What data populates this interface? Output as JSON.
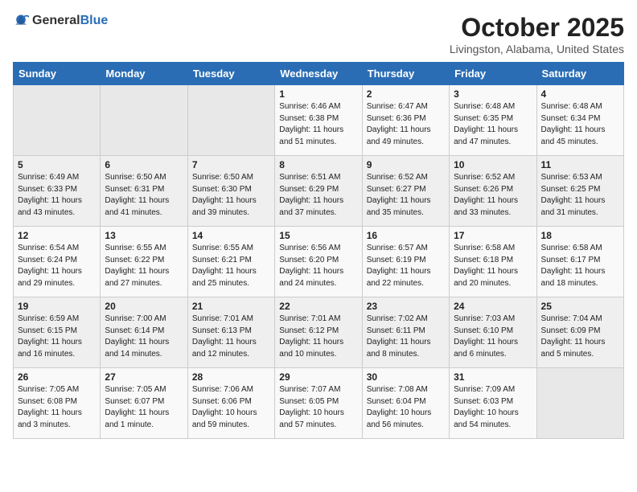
{
  "header": {
    "logo_general": "General",
    "logo_blue": "Blue",
    "month_title": "October 2025",
    "location": "Livingston, Alabama, United States"
  },
  "days_of_week": [
    "Sunday",
    "Monday",
    "Tuesday",
    "Wednesday",
    "Thursday",
    "Friday",
    "Saturday"
  ],
  "weeks": [
    [
      {
        "day": "",
        "info": ""
      },
      {
        "day": "",
        "info": ""
      },
      {
        "day": "",
        "info": ""
      },
      {
        "day": "1",
        "info": "Sunrise: 6:46 AM\nSunset: 6:38 PM\nDaylight: 11 hours\nand 51 minutes."
      },
      {
        "day": "2",
        "info": "Sunrise: 6:47 AM\nSunset: 6:36 PM\nDaylight: 11 hours\nand 49 minutes."
      },
      {
        "day": "3",
        "info": "Sunrise: 6:48 AM\nSunset: 6:35 PM\nDaylight: 11 hours\nand 47 minutes."
      },
      {
        "day": "4",
        "info": "Sunrise: 6:48 AM\nSunset: 6:34 PM\nDaylight: 11 hours\nand 45 minutes."
      }
    ],
    [
      {
        "day": "5",
        "info": "Sunrise: 6:49 AM\nSunset: 6:33 PM\nDaylight: 11 hours\nand 43 minutes."
      },
      {
        "day": "6",
        "info": "Sunrise: 6:50 AM\nSunset: 6:31 PM\nDaylight: 11 hours\nand 41 minutes."
      },
      {
        "day": "7",
        "info": "Sunrise: 6:50 AM\nSunset: 6:30 PM\nDaylight: 11 hours\nand 39 minutes."
      },
      {
        "day": "8",
        "info": "Sunrise: 6:51 AM\nSunset: 6:29 PM\nDaylight: 11 hours\nand 37 minutes."
      },
      {
        "day": "9",
        "info": "Sunrise: 6:52 AM\nSunset: 6:27 PM\nDaylight: 11 hours\nand 35 minutes."
      },
      {
        "day": "10",
        "info": "Sunrise: 6:52 AM\nSunset: 6:26 PM\nDaylight: 11 hours\nand 33 minutes."
      },
      {
        "day": "11",
        "info": "Sunrise: 6:53 AM\nSunset: 6:25 PM\nDaylight: 11 hours\nand 31 minutes."
      }
    ],
    [
      {
        "day": "12",
        "info": "Sunrise: 6:54 AM\nSunset: 6:24 PM\nDaylight: 11 hours\nand 29 minutes."
      },
      {
        "day": "13",
        "info": "Sunrise: 6:55 AM\nSunset: 6:22 PM\nDaylight: 11 hours\nand 27 minutes."
      },
      {
        "day": "14",
        "info": "Sunrise: 6:55 AM\nSunset: 6:21 PM\nDaylight: 11 hours\nand 25 minutes."
      },
      {
        "day": "15",
        "info": "Sunrise: 6:56 AM\nSunset: 6:20 PM\nDaylight: 11 hours\nand 24 minutes."
      },
      {
        "day": "16",
        "info": "Sunrise: 6:57 AM\nSunset: 6:19 PM\nDaylight: 11 hours\nand 22 minutes."
      },
      {
        "day": "17",
        "info": "Sunrise: 6:58 AM\nSunset: 6:18 PM\nDaylight: 11 hours\nand 20 minutes."
      },
      {
        "day": "18",
        "info": "Sunrise: 6:58 AM\nSunset: 6:17 PM\nDaylight: 11 hours\nand 18 minutes."
      }
    ],
    [
      {
        "day": "19",
        "info": "Sunrise: 6:59 AM\nSunset: 6:15 PM\nDaylight: 11 hours\nand 16 minutes."
      },
      {
        "day": "20",
        "info": "Sunrise: 7:00 AM\nSunset: 6:14 PM\nDaylight: 11 hours\nand 14 minutes."
      },
      {
        "day": "21",
        "info": "Sunrise: 7:01 AM\nSunset: 6:13 PM\nDaylight: 11 hours\nand 12 minutes."
      },
      {
        "day": "22",
        "info": "Sunrise: 7:01 AM\nSunset: 6:12 PM\nDaylight: 11 hours\nand 10 minutes."
      },
      {
        "day": "23",
        "info": "Sunrise: 7:02 AM\nSunset: 6:11 PM\nDaylight: 11 hours\nand 8 minutes."
      },
      {
        "day": "24",
        "info": "Sunrise: 7:03 AM\nSunset: 6:10 PM\nDaylight: 11 hours\nand 6 minutes."
      },
      {
        "day": "25",
        "info": "Sunrise: 7:04 AM\nSunset: 6:09 PM\nDaylight: 11 hours\nand 5 minutes."
      }
    ],
    [
      {
        "day": "26",
        "info": "Sunrise: 7:05 AM\nSunset: 6:08 PM\nDaylight: 11 hours\nand 3 minutes."
      },
      {
        "day": "27",
        "info": "Sunrise: 7:05 AM\nSunset: 6:07 PM\nDaylight: 11 hours\nand 1 minute."
      },
      {
        "day": "28",
        "info": "Sunrise: 7:06 AM\nSunset: 6:06 PM\nDaylight: 10 hours\nand 59 minutes."
      },
      {
        "day": "29",
        "info": "Sunrise: 7:07 AM\nSunset: 6:05 PM\nDaylight: 10 hours\nand 57 minutes."
      },
      {
        "day": "30",
        "info": "Sunrise: 7:08 AM\nSunset: 6:04 PM\nDaylight: 10 hours\nand 56 minutes."
      },
      {
        "day": "31",
        "info": "Sunrise: 7:09 AM\nSunset: 6:03 PM\nDaylight: 10 hours\nand 54 minutes."
      },
      {
        "day": "",
        "info": ""
      }
    ]
  ]
}
